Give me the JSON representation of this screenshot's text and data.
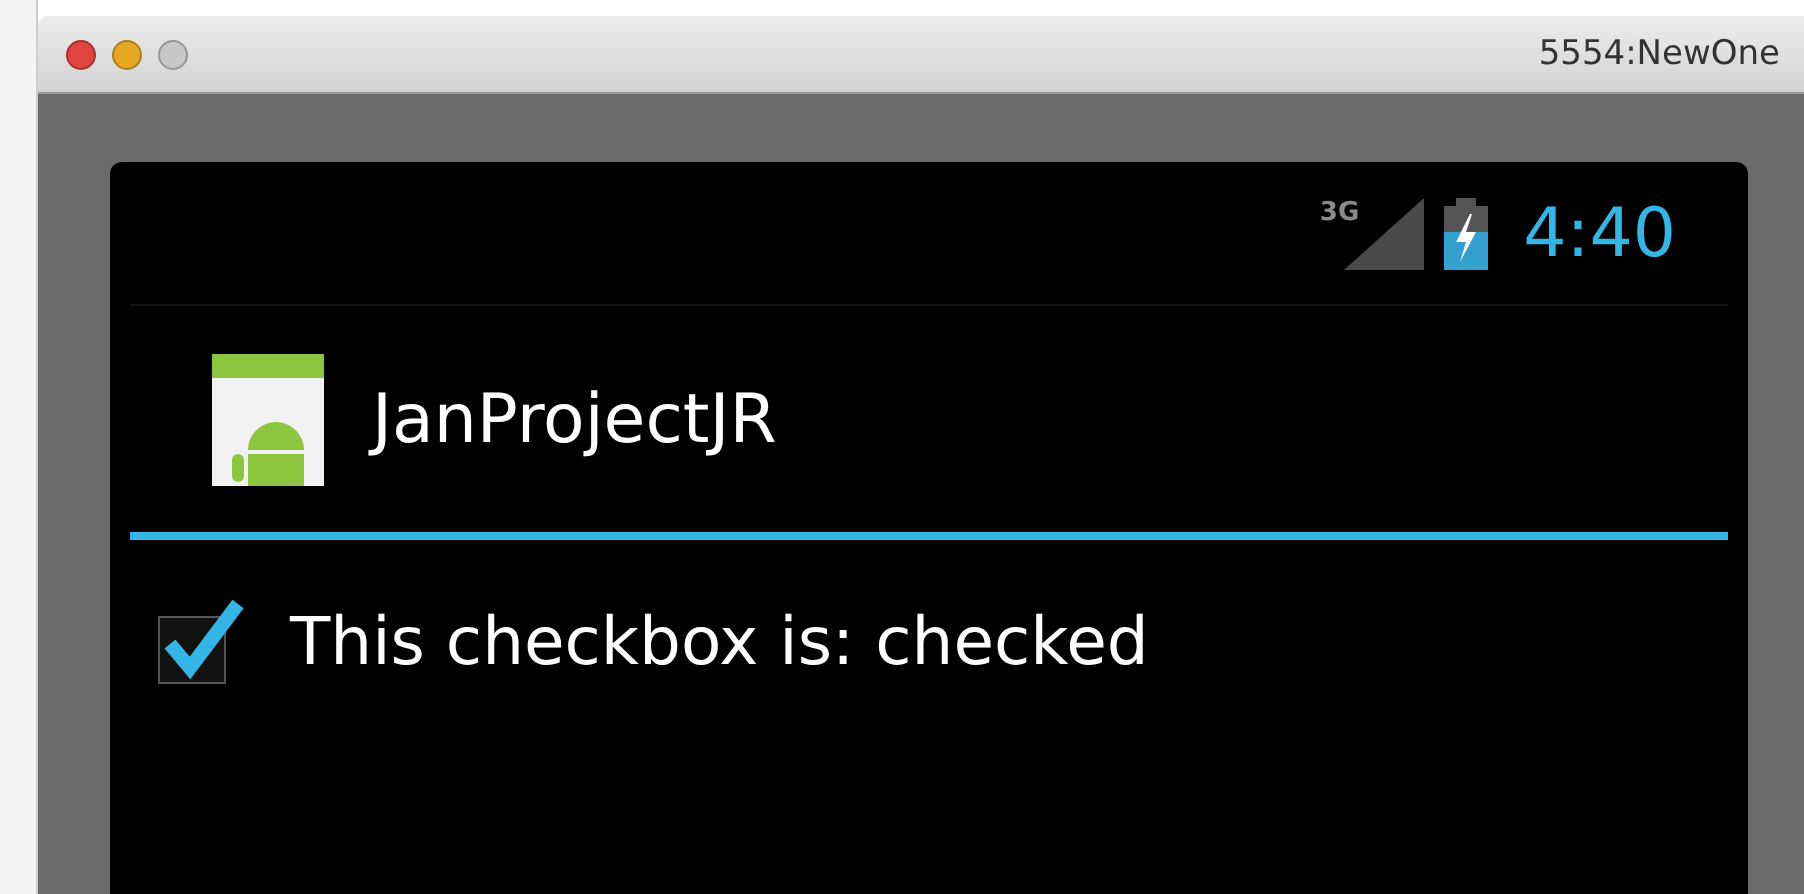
{
  "window": {
    "title": "5554:NewOne"
  },
  "status_bar": {
    "network": "3G",
    "time": "4:40"
  },
  "action_bar": {
    "title": "JanProjectJR"
  },
  "checkbox": {
    "label": "This checkbox is: checked",
    "checked": true
  }
}
